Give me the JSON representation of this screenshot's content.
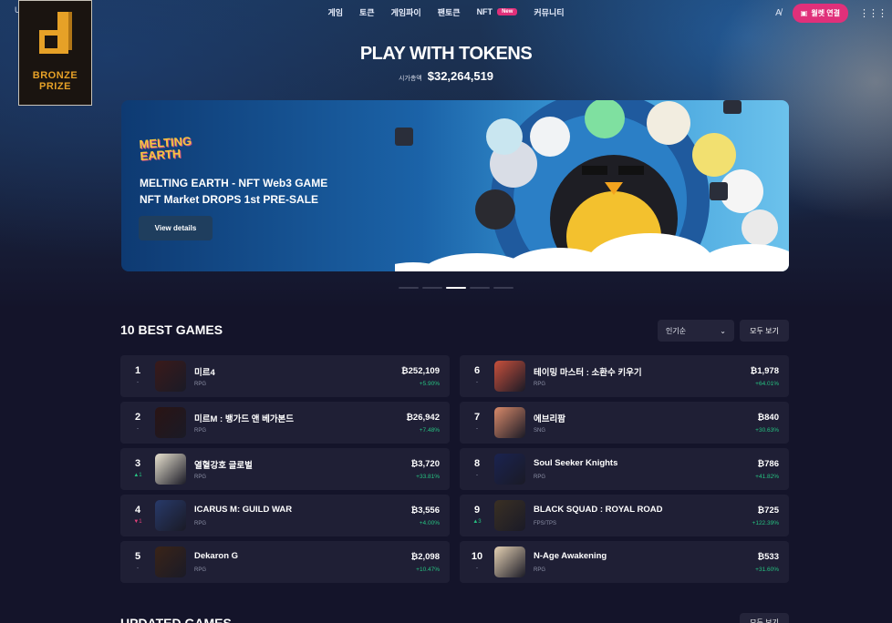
{
  "nav": {
    "items": [
      "게임",
      "토큰",
      "게임파이",
      "팬토큰",
      "NFT",
      "커뮤니티"
    ],
    "new_badge": "New",
    "wallet_button": "월렛 연결",
    "left_char": "U"
  },
  "prize": {
    "line1": "BRONZE",
    "line2": "PRIZE"
  },
  "hero": {
    "title": "PLAY WITH TOKENS",
    "cap_label": "시가총액",
    "cap_value": "$32,264,519"
  },
  "banner": {
    "logo_line1": "MELTING",
    "logo_line2": "EARTH",
    "line1": "MELTING EARTH - NFT Web3 GAME",
    "line2": "NFT Market DROPS 1st PRE-SALE",
    "button": "View details",
    "slides_total": 5,
    "slide_active": 3
  },
  "best": {
    "title": "10 BEST GAMES",
    "sort_value": "인기순",
    "see_all": "모두 보기",
    "games": [
      {
        "rank": "1",
        "delta": "-",
        "trend": "none",
        "name": "미르4",
        "genre": "RPG",
        "price": "₿252,109",
        "pct": "+5.90%",
        "color": "#3a1a1a"
      },
      {
        "rank": "6",
        "delta": "-",
        "trend": "none",
        "name": "테이밍 마스터 : 소환수 키우기",
        "genre": "RPG",
        "price": "₿1,978",
        "pct": "+64.01%",
        "color": "#c8503c"
      },
      {
        "rank": "2",
        "delta": "-",
        "trend": "none",
        "name": "미르M : 뱅가드 앤 베가본드",
        "genre": "RPG",
        "price": "₿26,942",
        "pct": "+7.48%",
        "color": "#2a1414"
      },
      {
        "rank": "7",
        "delta": "-",
        "trend": "none",
        "name": "에브리팜",
        "genre": "SNG",
        "price": "₿840",
        "pct": "+30.63%",
        "color": "#d98a6a"
      },
      {
        "rank": "3",
        "delta": "▲1",
        "trend": "up",
        "name": "열혈강호 글로벌",
        "genre": "RPG",
        "price": "₿3,720",
        "pct": "+33.81%",
        "color": "#e8e2d0"
      },
      {
        "rank": "8",
        "delta": "-",
        "trend": "none",
        "name": "Soul Seeker Knights",
        "genre": "RPG",
        "price": "₿786",
        "pct": "+41.82%",
        "color": "#1a2350"
      },
      {
        "rank": "4",
        "delta": "▼1",
        "trend": "down",
        "name": "ICARUS M: GUILD WAR",
        "genre": "RPG",
        "price": "₿3,556",
        "pct": "+4.00%",
        "color": "#283a6a"
      },
      {
        "rank": "9",
        "delta": "▲3",
        "trend": "up",
        "name": "BLACK SQUAD : ROYAL ROAD",
        "genre": "FPS/TPS",
        "price": "₿725",
        "pct": "+122.39%",
        "color": "#3a3024"
      },
      {
        "rank": "5",
        "delta": "-",
        "trend": "none",
        "name": "Dekaron G",
        "genre": "RPG",
        "price": "₿2,098",
        "pct": "+10.47%",
        "color": "#3a2418"
      },
      {
        "rank": "10",
        "delta": "-",
        "trend": "none",
        "name": "N-Age Awakening",
        "genre": "RPG",
        "price": "₿533",
        "pct": "+31.60%",
        "color": "#e6d2b4"
      }
    ]
  },
  "updated": {
    "title": "UPDATED GAMES",
    "see_all": "모두 보기"
  }
}
